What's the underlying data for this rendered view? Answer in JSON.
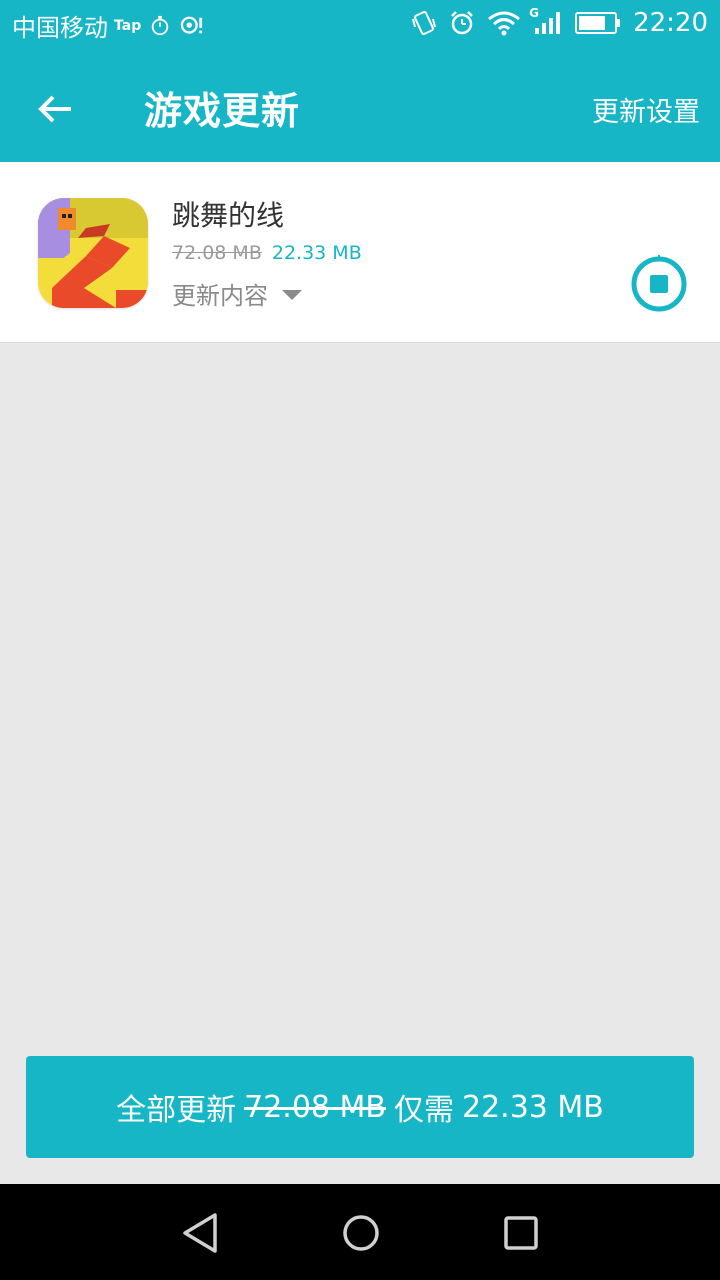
{
  "status_bar": {
    "carrier": "中国移动",
    "tap_label": "Tap",
    "network_type": "G",
    "time": "22:20"
  },
  "app_bar": {
    "title": "游戏更新",
    "settings_label": "更新设置"
  },
  "updates": [
    {
      "name": "跳舞的线",
      "old_size": "72.08 MB",
      "new_size": "22.33 MB",
      "changelog_label": "更新内容"
    }
  ],
  "update_all": {
    "label": "全部更新",
    "old_size": "72.08 MB",
    "only_label": "仅需",
    "new_size": "22.33 MB"
  },
  "colors": {
    "accent": "#16b6c6",
    "background": "#e8e8e8",
    "card": "#ffffff"
  }
}
